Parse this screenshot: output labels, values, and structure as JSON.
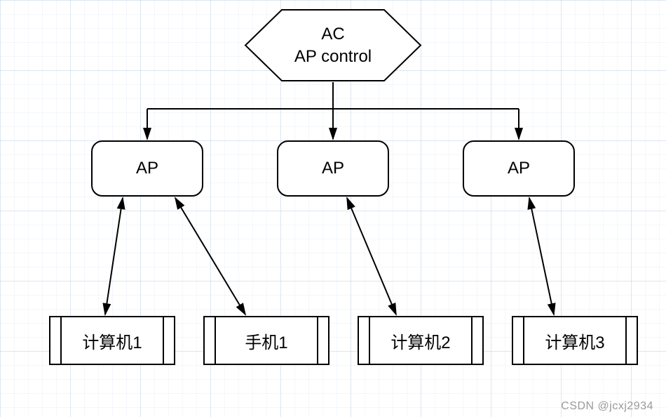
{
  "diagram": {
    "controller": {
      "line1": "AC",
      "line2": "AP control"
    },
    "aps": [
      {
        "label": "AP"
      },
      {
        "label": "AP"
      },
      {
        "label": "AP"
      }
    ],
    "devices": [
      {
        "label": "计算机1"
      },
      {
        "label": "手机1"
      },
      {
        "label": "计算机2"
      },
      {
        "label": "计算机3"
      }
    ]
  },
  "watermark": "CSDN @jcxj2934"
}
